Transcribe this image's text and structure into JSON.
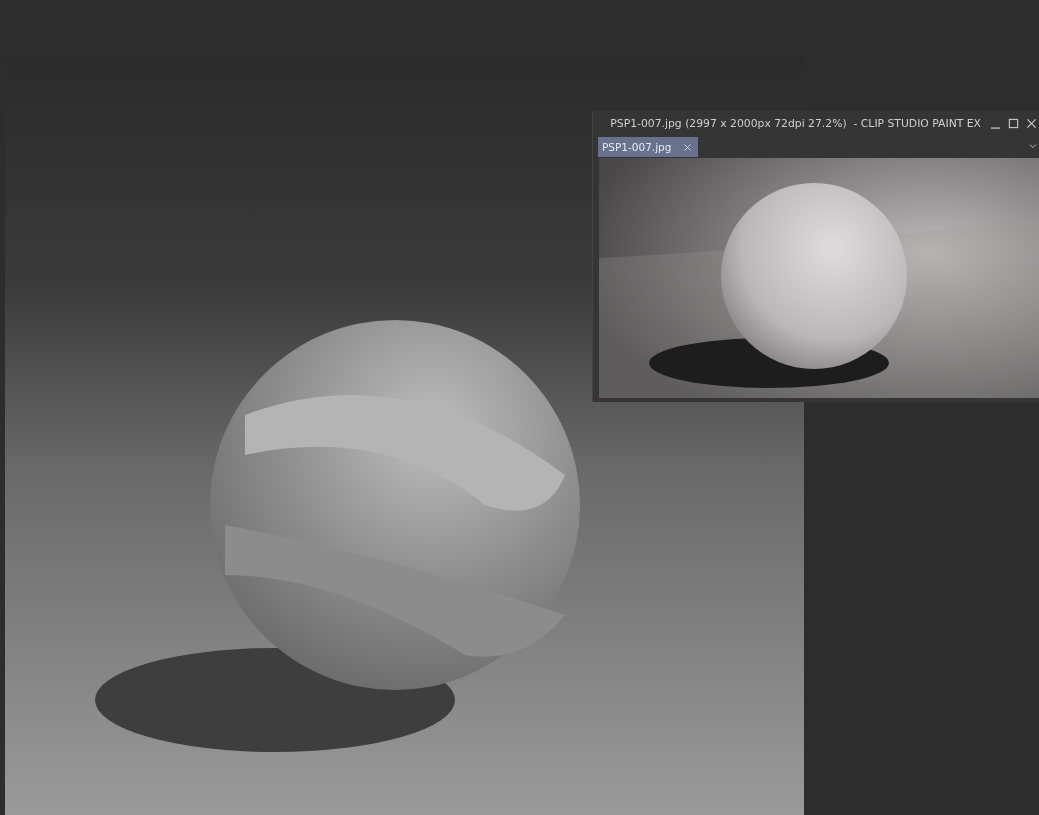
{
  "window": {
    "title": "PSP1-007.jpg (2997 x 2000px 72dpi 27.2%)  - CLIP STUDIO PAINT EX"
  },
  "tabs": [
    {
      "label": "PSP1-007.jpg",
      "selected": true
    }
  ]
}
